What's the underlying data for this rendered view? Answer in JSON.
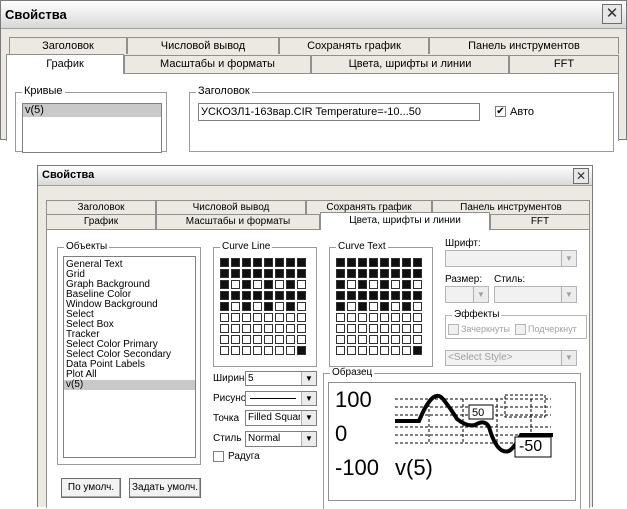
{
  "dialog_title": "Свойства",
  "tabs_row1": [
    "Заголовок",
    "Числовой вывод",
    "Сохранять график",
    "Панель инструментов"
  ],
  "tabs_row2": [
    "График",
    "Масштабы и форматы",
    "Цвета, шрифты и линии",
    "FFT"
  ],
  "top_dialog": {
    "active_tab": "График",
    "curves_group": "Кривые",
    "curves": [
      "v(5)"
    ],
    "header_group": "Заголовок",
    "header_value": "УСКОЗЛ1-163вар.CIR Temperature=-10...50",
    "auto_label": "Авто",
    "auto_checked": true
  },
  "bottom_dialog": {
    "active_tab": "Цвета, шрифты и линии",
    "objects_group": "Объекты",
    "objects": [
      "General Text",
      "Grid",
      "Graph Background",
      "Baseline Color",
      "Window Background",
      "Select",
      "Select Box",
      "Tracker",
      "Select Color Primary",
      "Select Color Secondary",
      "Data Point Labels",
      "Plot All",
      "v(5)"
    ],
    "selected_object": "v(5)",
    "curve_line_group": "Curve Line",
    "curve_text_group": "Curve Text",
    "width_label": "Ширина",
    "width_value": "5",
    "pattern_label": "Рисунок",
    "point_label": "Точка",
    "point_value": "Filled Square",
    "style_label": "Стиль",
    "style_value": "Normal",
    "rainbow_label": "Радуга",
    "font_label": "Шрифт:",
    "size_label": "Размер:",
    "font_style_label": "Стиль:",
    "effects_group": "Эффекты",
    "strike_label": "Зачеркнуты",
    "underline_label": "Подчеркнут",
    "select_style_placeholder": "<Select Style>",
    "sample_group": "Образец",
    "sample_top": "100",
    "sample_mid": "0",
    "sample_bottom": "-100",
    "sample_curve": "v(5)",
    "sample_label_50": "50",
    "sample_label_m50": "-50",
    "default_button": "По умолч.",
    "set_default_button": "Задать умолч."
  }
}
